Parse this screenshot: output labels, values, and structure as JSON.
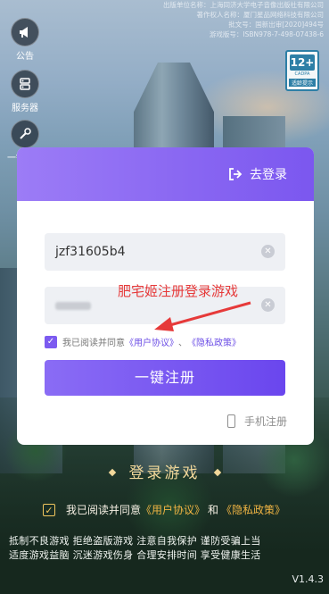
{
  "notice": {
    "lines": [
      "出版单位名称：上海同济大学电子音像出版社有限公司",
      "著作权人名称：厦门星品网络科技有限公司",
      "批文号：国新出审[2020]494号",
      "游戏版号：ISBN978-7-498-07438-6"
    ]
  },
  "side_buttons": {
    "announcement": "公告",
    "server": "服务器",
    "repair": "一键修复"
  },
  "age_rating": {
    "number": "12+",
    "org": "CADPA",
    "tip": "适龄提示"
  },
  "card": {
    "login_link": "去登录",
    "username_value": "jzf31605b4",
    "overlay_caption": "肥宅姬注册登录游戏",
    "agree_prefix": "我已阅读并同意",
    "user_agreement": "《用户协议》",
    "separator": "、",
    "privacy_policy": "《隐私政策》",
    "register_button": "一键注册",
    "phone_register": "手机注册"
  },
  "bottom": {
    "title": "登录游戏",
    "agree_prefix": "我已阅读并同意",
    "user_agreement": "《用户协议》",
    "and": "和",
    "privacy_policy": "《隐私政策》",
    "health_line1": "抵制不良游戏 拒绝盗版游戏 注意自我保护 谨防受骗上当",
    "health_line2": "适度游戏益脑 沉迷游戏伤身 合理安排时间 享受健康生活",
    "version": "V1.4.3"
  },
  "colors": {
    "accent": "#7b57ef",
    "overlay_red": "#e63a3a",
    "gold": "#f0b443"
  }
}
